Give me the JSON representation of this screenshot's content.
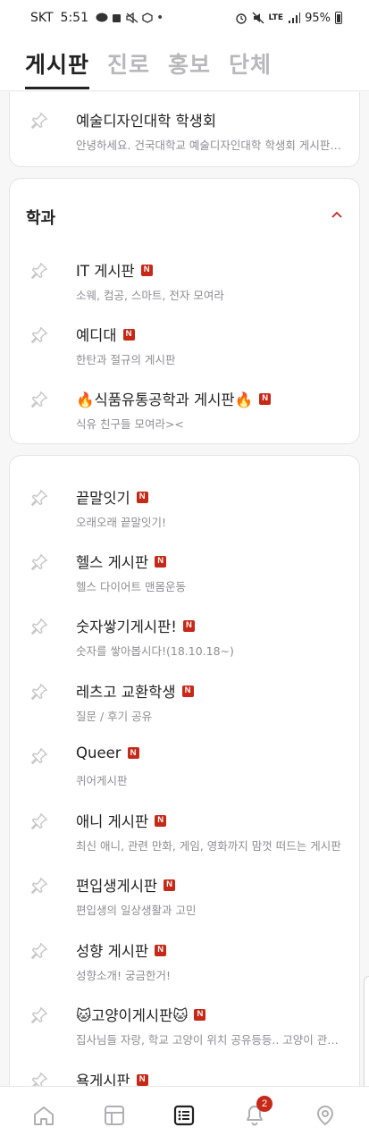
{
  "status_bar": {
    "carrier": "SKT",
    "time": "5:51",
    "network": "LTE",
    "battery": "95%"
  },
  "header": {
    "tabs": [
      {
        "label": "게시판",
        "active": true
      },
      {
        "label": "진로",
        "active": false
      },
      {
        "label": "홍보",
        "active": false
      },
      {
        "label": "단체",
        "active": false
      }
    ]
  },
  "boards_top": [
    {
      "title": "예술디자인대학 학생회",
      "desc": "안녕하세요. 건국대학교 예술디자인대학 학생회 게시판입니다.",
      "new": false
    }
  ],
  "section_dept": {
    "title": "학과",
    "items": [
      {
        "title": "IT 게시판",
        "desc": "소웨, 컴공, 스마트, 전자 모여라",
        "new": true
      },
      {
        "title": "예디대",
        "desc": "한탄과 절규의 게시판",
        "new": true
      },
      {
        "title": "🔥식품유통공학과 게시판🔥",
        "desc": "식유 친구들 모여라><",
        "new": true
      }
    ]
  },
  "boards_misc": [
    {
      "title": "끝말잇기",
      "desc": "오래오래 끝말잇기!",
      "new": true
    },
    {
      "title": "헬스 게시판",
      "desc": "헬스 다이어트 맨몸운동",
      "new": true
    },
    {
      "title": "숫자쌓기게시판!",
      "desc": "숫자를 쌓아봅시다!(18.10.18~)",
      "new": true
    },
    {
      "title": "레츠고 교환학생",
      "desc": "질문 / 후기 공유",
      "new": true
    },
    {
      "title": "Queer",
      "desc": "퀴어게시판",
      "new": true
    },
    {
      "title": "애니 게시판",
      "desc": "최신 애니, 관련 만화, 게임, 영화까지 맘껏 떠드는 게시판",
      "new": true
    },
    {
      "title": "편입생게시판",
      "desc": "편입생의 일상생활과 고민",
      "new": true
    },
    {
      "title": "성향 게시판",
      "desc": "성향소개! 궁금한거!",
      "new": true
    },
    {
      "title": "🐱고양이게시판🐱",
      "desc": "집사님들 자랑, 학교 고양이 위치 공유등등.. 고양이 관련 게시판",
      "new": true
    },
    {
      "title": "욕게시판",
      "desc": "",
      "new": true
    }
  ],
  "badge_new_label": "N",
  "bottom_nav": {
    "items": [
      "home-icon",
      "timetable-icon",
      "board-icon",
      "notification-icon",
      "campus-pick-icon"
    ],
    "notification_count": "2"
  },
  "colors": {
    "accent": "#c62917",
    "text_primary": "#222222",
    "text_secondary": "#8e8e93",
    "tab_inactive": "#b8b8bc"
  }
}
